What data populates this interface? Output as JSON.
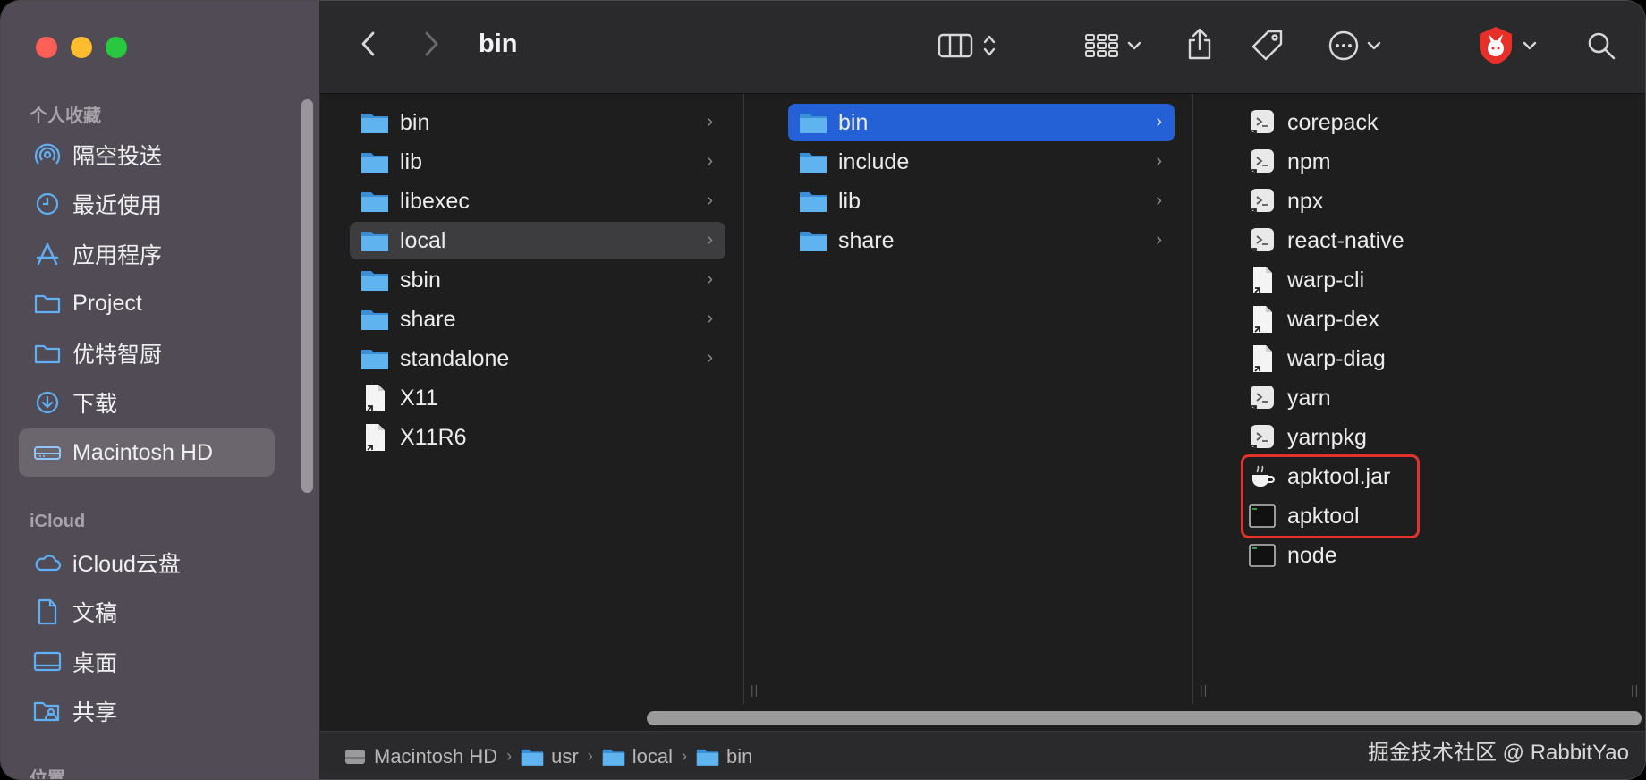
{
  "window": {
    "title": "bin"
  },
  "sidebar": {
    "sections": [
      {
        "header": "个人收藏",
        "items": [
          {
            "label": "隔空投送",
            "icon": "airdrop-icon"
          },
          {
            "label": "最近使用",
            "icon": "clock-icon"
          },
          {
            "label": "应用程序",
            "icon": "applications-icon"
          },
          {
            "label": "Project",
            "icon": "folder-icon"
          },
          {
            "label": "优特智厨",
            "icon": "folder-icon"
          },
          {
            "label": "下载",
            "icon": "download-icon"
          },
          {
            "label": "Macintosh HD",
            "icon": "harddrive-icon",
            "selected": true
          }
        ]
      },
      {
        "header": "iCloud",
        "items": [
          {
            "label": "iCloud云盘",
            "icon": "cloud-icon"
          },
          {
            "label": "文稿",
            "icon": "document-icon"
          },
          {
            "label": "桌面",
            "icon": "desktop-icon"
          },
          {
            "label": "共享",
            "icon": "shared-folder-icon"
          }
        ]
      },
      {
        "header": "位置",
        "items": []
      }
    ]
  },
  "columns": [
    {
      "items": [
        {
          "name": "bin",
          "type": "folder",
          "chevron": true
        },
        {
          "name": "lib",
          "type": "folder",
          "chevron": true
        },
        {
          "name": "libexec",
          "type": "folder",
          "chevron": true
        },
        {
          "name": "local",
          "type": "folder",
          "chevron": true,
          "selected": "gray"
        },
        {
          "name": "sbin",
          "type": "folder",
          "chevron": true
        },
        {
          "name": "share",
          "type": "folder",
          "chevron": true
        },
        {
          "name": "standalone",
          "type": "folder",
          "chevron": true
        },
        {
          "name": "X11",
          "type": "alias"
        },
        {
          "name": "X11R6",
          "type": "alias"
        }
      ]
    },
    {
      "items": [
        {
          "name": "bin",
          "type": "folder",
          "chevron": true,
          "selected": "blue"
        },
        {
          "name": "include",
          "type": "folder",
          "chevron": true
        },
        {
          "name": "lib",
          "type": "folder",
          "chevron": true
        },
        {
          "name": "share",
          "type": "folder",
          "chevron": true
        }
      ]
    },
    {
      "items": [
        {
          "name": "corepack",
          "type": "script-alias"
        },
        {
          "name": "npm",
          "type": "script-alias"
        },
        {
          "name": "npx",
          "type": "script-alias"
        },
        {
          "name": "react-native",
          "type": "script-alias"
        },
        {
          "name": "warp-cli",
          "type": "alias"
        },
        {
          "name": "warp-dex",
          "type": "alias"
        },
        {
          "name": "warp-diag",
          "type": "alias"
        },
        {
          "name": "yarn",
          "type": "script-alias"
        },
        {
          "name": "yarnpkg",
          "type": "script-alias"
        },
        {
          "name": "apktool.jar",
          "type": "jar"
        },
        {
          "name": "apktool",
          "type": "exec"
        },
        {
          "name": "node",
          "type": "exec"
        }
      ]
    }
  ],
  "pathbar": {
    "crumbs": [
      {
        "label": "Macintosh HD",
        "icon": "harddrive-icon"
      },
      {
        "label": "usr",
        "icon": "folder-icon"
      },
      {
        "label": "local",
        "icon": "folder-icon"
      },
      {
        "label": "bin",
        "icon": "folder-icon"
      }
    ]
  },
  "watermark": "掘金技术社区 @ RabbitYao",
  "colors": {
    "accent": "#2460d6",
    "folder": "#4aa3e8",
    "highlight": "#e5322d"
  }
}
